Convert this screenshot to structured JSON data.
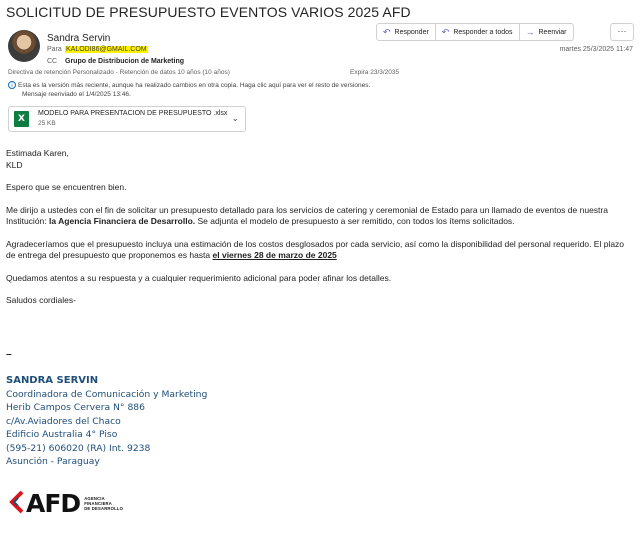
{
  "subject": "SOLICITUD DE PRESUPUESTO EVENTOS VARIOS 2025 AFD",
  "header": {
    "sender": "Sandra Servin",
    "to_label": "Para",
    "to_value": "KALODI86@GMAIL.COM",
    "cc_label": "CC",
    "cc_value": "Grupo de Distribucion de Marketing",
    "date": "martes 25/3/2025 11:47",
    "retention": "Directiva de retención   Personalizado - Retención de datos 10 años (10 años)",
    "expires": "Expira    23/3/2035",
    "info_line1": "Esta es la versión más reciente, aunque ha realizado cambios en otra copia. Haga clic aquí para ver el resto de versiones.",
    "info_line2": "Mensaje reenviado el 1/4/2025 13:46."
  },
  "actions": {
    "reply": "Responder",
    "reply_all": "Responder a todos",
    "forward": "Reenviar",
    "more": "···"
  },
  "attachment": {
    "name": "MODELO PARA PRESENTACION DE PRESUPUESTO .xlsx",
    "size": "25 KB",
    "icon": "excel-icon"
  },
  "body": {
    "greeting1": "Estimada Karen,",
    "greeting2": "KLD",
    "p1": "Espero que se encuentren bien.",
    "p2a": "Me dirijo a ustedes con el fin de solicitar un presupuesto detallado para los servicios de catering y ceremonial de Estado para un llamado de eventos de nuestra Institución: ",
    "p2b": "la Agencia Financiera de Desarrollo.",
    "p2c": "  Se adjunta el modelo de presupuesto a ser remitido, con todos los ítems solicitados.",
    "p3a": "Agradeceríamos que el presupuesto incluya una estimación de los costos desglosados por cada servicio, así como la disponibilidad del personal requerido. El plazo de entrega del presupuesto que proponemos es hasta ",
    "p3b": "el viernes 28 de marzo de 2025",
    "p4": "Quedamos atentos a su respuesta y a cualquier requerimiento adicional para poder afinar los detalles.",
    "p5": "Saludos cordiales-"
  },
  "signature": {
    "dash": "–",
    "name": "SANDRA SERVIN",
    "title": "Coordinadora de Comunicación y Marketing",
    "address1": "Herib Campos Cervera N° 886",
    "address2": "c/Av.Aviadores del Chaco",
    "address3": "Edificio Australia 4° Piso",
    "phone": "(595-21) 606020 (RA) Int. 9238",
    "city": "Asunción - Paraguay"
  },
  "logo": {
    "text": "AFD",
    "sub1": "AGENCIA",
    "sub2": "FINANCIERA",
    "sub3": "DE DESARROLLO",
    "red": "#d7191e"
  }
}
